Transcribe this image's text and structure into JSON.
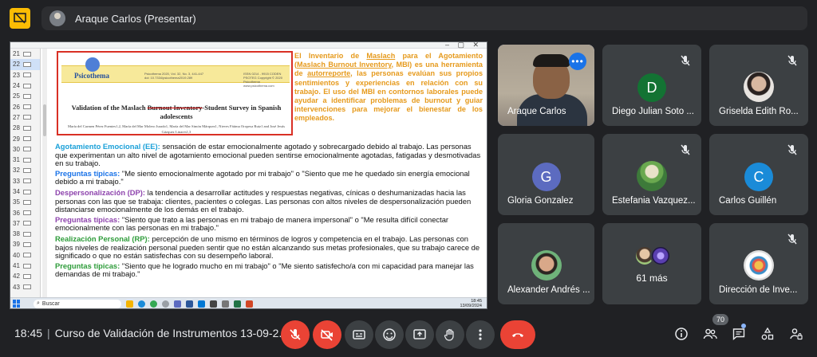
{
  "header": {
    "presenter_title": "Araque Carlos (Presentar)"
  },
  "presentation": {
    "slide_numbers": [
      "21",
      "22",
      "23",
      "24",
      "25",
      "26",
      "27",
      "28",
      "29",
      "30",
      "31",
      "32",
      "33",
      "34",
      "35",
      "36",
      "37",
      "38",
      "39",
      "40",
      "41",
      "42",
      "43"
    ],
    "paper": {
      "journal": "Psicothema",
      "meta_left": "Psicothema 2020, Vol. 32, No. 3, 441-447 doi: 10.7334/psicothema2019.289",
      "meta_right": "ISSN 0214 - 9915 CODEN PSOTEG Copyright © 2020 Psicothema www.psicothema.com",
      "title_a": "Validation of the Maslach ",
      "title_strike": "Burnout Inventory",
      "title_b": "-Student Survey in Spanish adolescents",
      "authors": "María del Carmen Pérez Fuentes1,2, María del Mar Molero Jurado1, María del Mar Simón Márquez1, Nieves Fátima Oropesa Ruiz1 and José Jesús Gázquez Linares1,3"
    },
    "intro_text_a": "El Inventario de ",
    "intro_u1": "Maslach",
    "intro_text_b": " para el Agotamiento (",
    "intro_u2": "Maslach Burnout Inventory",
    "intro_text_c": ", MBI) es una herramienta de ",
    "intro_u3": "autorreporte",
    "intro_text_d": ", las personas evalúan sus propios sentimientos y experiencias en relación con su trabajo. El uso del MBI en contornos laborales puede ayudar a identificar problemas de burnout y guiar intervenciones para mejorar el bienestar de los empleados.",
    "ee_label": "Agotamiento Emocional (EE):",
    "ee_text": " sensación de estar emocionalmente agotado y sobrecargado debido al trabajo. Las personas que experimentan un alto nivel de agotamiento emocional pueden sentirse emocionalmente agotadas, fatigadas y desmotivadas en su trabajo.",
    "ee_pt_label": "Preguntas típicas:",
    "ee_pt_text": " \"Me siento emocionalmente agotado por mi trabajo\" o \"Siento que me he quedado sin energía emocional debido a mi trabajo.\"",
    "dp_label": "Despersonalización (DP):",
    "dp_text": " la tendencia a desarrollar actitudes y respuestas negativas, cínicas o deshumanizadas hacia las personas con las que se trabaja: clientes, pacientes o colegas. Las personas con altos niveles de despersonalización pueden distanciarse emocionalmente de los demás en el trabajo.",
    "dp_pt_label": "Preguntas típicas:",
    "dp_pt_text": " \"Siento que trato a las personas en mi trabajo de manera impersonal\" o \"Me resulta difícil conectar emocionalmente con las personas en mi trabajo.\"",
    "rp_label": "Realización Personal (RP):",
    "rp_text": " percepción de uno mismo en términos de logros y competencia en el trabajo. Las personas con bajos niveles de realización personal pueden sentir que no están alcanzando sus metas profesionales, que su trabajo carece de significado o que no están satisfechas con su desempeño laboral.",
    "rp_pt_label": "Preguntas típicas:",
    "rp_pt_text": " \"Siento que he logrado mucho en mi trabajo\" o \"Me siento satisfecho/a con mi capacidad para manejar las demandas de mi trabajo.\"",
    "taskbar": {
      "search_placeholder": "Buscar",
      "clock_time": "18:45",
      "clock_date": "13/09/2024"
    }
  },
  "participants": [
    {
      "name": "Araque Carlos",
      "type": "camera"
    },
    {
      "name": "Diego Julian Soto ...",
      "type": "initial",
      "initial": "D",
      "color": "#137333"
    },
    {
      "name": "Griselda Edith Ro...",
      "type": "photo"
    },
    {
      "name": "Gloria Gonzalez",
      "type": "initial",
      "initial": "G",
      "color": "#5c6bc0"
    },
    {
      "name": "Estefania Vazquez...",
      "type": "photo"
    },
    {
      "name": "Carlos Guillén",
      "type": "initial",
      "initial": "C",
      "color": "#1a8bd8"
    },
    {
      "name": "Alexander Andrés ...",
      "type": "photo"
    },
    {
      "name": "61 más",
      "type": "more"
    },
    {
      "name": "Dirección de Inve...",
      "type": "photo"
    }
  ],
  "bottom": {
    "time": "18:45",
    "meeting_title": "Curso de Validación de Instrumentos 13-09-2...",
    "participant_count": "70"
  },
  "colors": {
    "end_call": "#ea4335",
    "accent": "#8ab4f8"
  }
}
